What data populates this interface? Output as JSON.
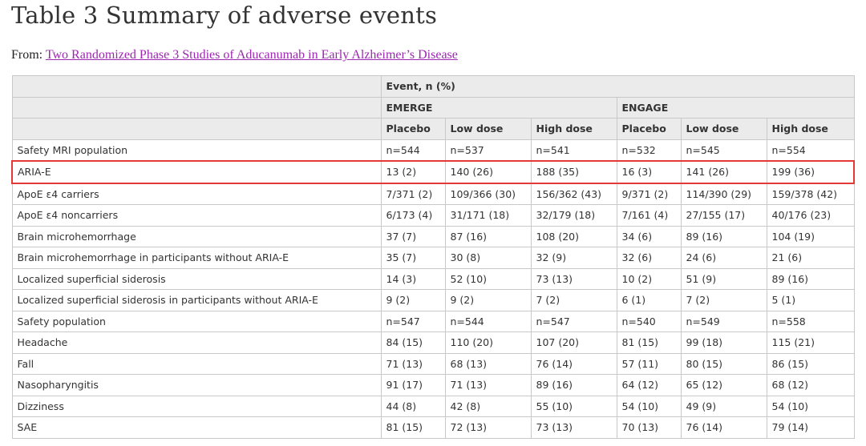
{
  "title": "Table 3 Summary of adverse events",
  "from": {
    "label": "From:",
    "link_text": "Two Randomized Phase 3 Studies of Aducanumab in Early Alzheimer’s Disease"
  },
  "table": {
    "header_event": "Event, n (%)",
    "studies": [
      "EMERGE",
      "ENGAGE"
    ],
    "arms": [
      "Placebo",
      "Low dose",
      "High dose",
      "Placebo",
      "Low dose",
      "High dose"
    ],
    "highlight_color": "#e53935",
    "rows": [
      {
        "label": "Safety MRI population",
        "cells": [
          "n=544",
          "n=537",
          "n=541",
          "n=532",
          "n=545",
          "n=554"
        ]
      },
      {
        "label": "ARIA-E",
        "cells": [
          "13 (2)",
          "140 (26)",
          "188 (35)",
          "16 (3)",
          "141 (26)",
          "199 (36)"
        ]
      },
      {
        "label": "ApoE ε4 carriers",
        "cells": [
          "7/371 (2)",
          "109/366 (30)",
          "156/362 (43)",
          "9/371 (2)",
          "114/390 (29)",
          "159/378 (42)"
        ]
      },
      {
        "label": "ApoE ε4 noncarriers",
        "cells": [
          "6/173 (4)",
          "31/171 (18)",
          "32/179 (18)",
          "7/161 (4)",
          "27/155 (17)",
          "40/176 (23)"
        ]
      },
      {
        "label": "Brain microhemorrhage",
        "cells": [
          "37 (7)",
          "87 (16)",
          "108 (20)",
          "34 (6)",
          "89 (16)",
          "104 (19)"
        ]
      },
      {
        "label": "Brain microhemorrhage in participants without ARIA-E",
        "cells": [
          "35 (7)",
          "30 (8)",
          "32 (9)",
          "32 (6)",
          "24 (6)",
          "21 (6)"
        ]
      },
      {
        "label": "Localized superficial siderosis",
        "cells": [
          "14 (3)",
          "52 (10)",
          "73 (13)",
          "10 (2)",
          "51 (9)",
          "89 (16)"
        ]
      },
      {
        "label": "Localized superficial siderosis in participants without ARIA-E",
        "cells": [
          "9 (2)",
          "9 (2)",
          "7 (2)",
          "6 (1)",
          "7 (2)",
          "5 (1)"
        ]
      },
      {
        "label": "Safety population",
        "cells": [
          "n=547",
          "n=544",
          "n=547",
          "n=540",
          "n=549",
          "n=558"
        ]
      },
      {
        "label": "Headache",
        "cells": [
          "84 (15)",
          "110 (20)",
          "107 (20)",
          "81 (15)",
          "99 (18)",
          "115 (21)"
        ]
      },
      {
        "label": "Fall",
        "cells": [
          "71 (13)",
          "68 (13)",
          "76 (14)",
          "57 (11)",
          "80 (15)",
          "86 (15)"
        ]
      },
      {
        "label": "Nasopharyngitis",
        "cells": [
          "91 (17)",
          "71 (13)",
          "89 (16)",
          "64 (12)",
          "65 (12)",
          "68 (12)"
        ]
      },
      {
        "label": "Dizziness",
        "cells": [
          "44 (8)",
          "42 (8)",
          "55 (10)",
          "54 (10)",
          "49 (9)",
          "54 (10)"
        ]
      },
      {
        "label": "SAE",
        "cells": [
          "81 (15)",
          "72 (13)",
          "73 (13)",
          "70 (13)",
          "76 (14)",
          "79 (14)"
        ]
      }
    ]
  }
}
